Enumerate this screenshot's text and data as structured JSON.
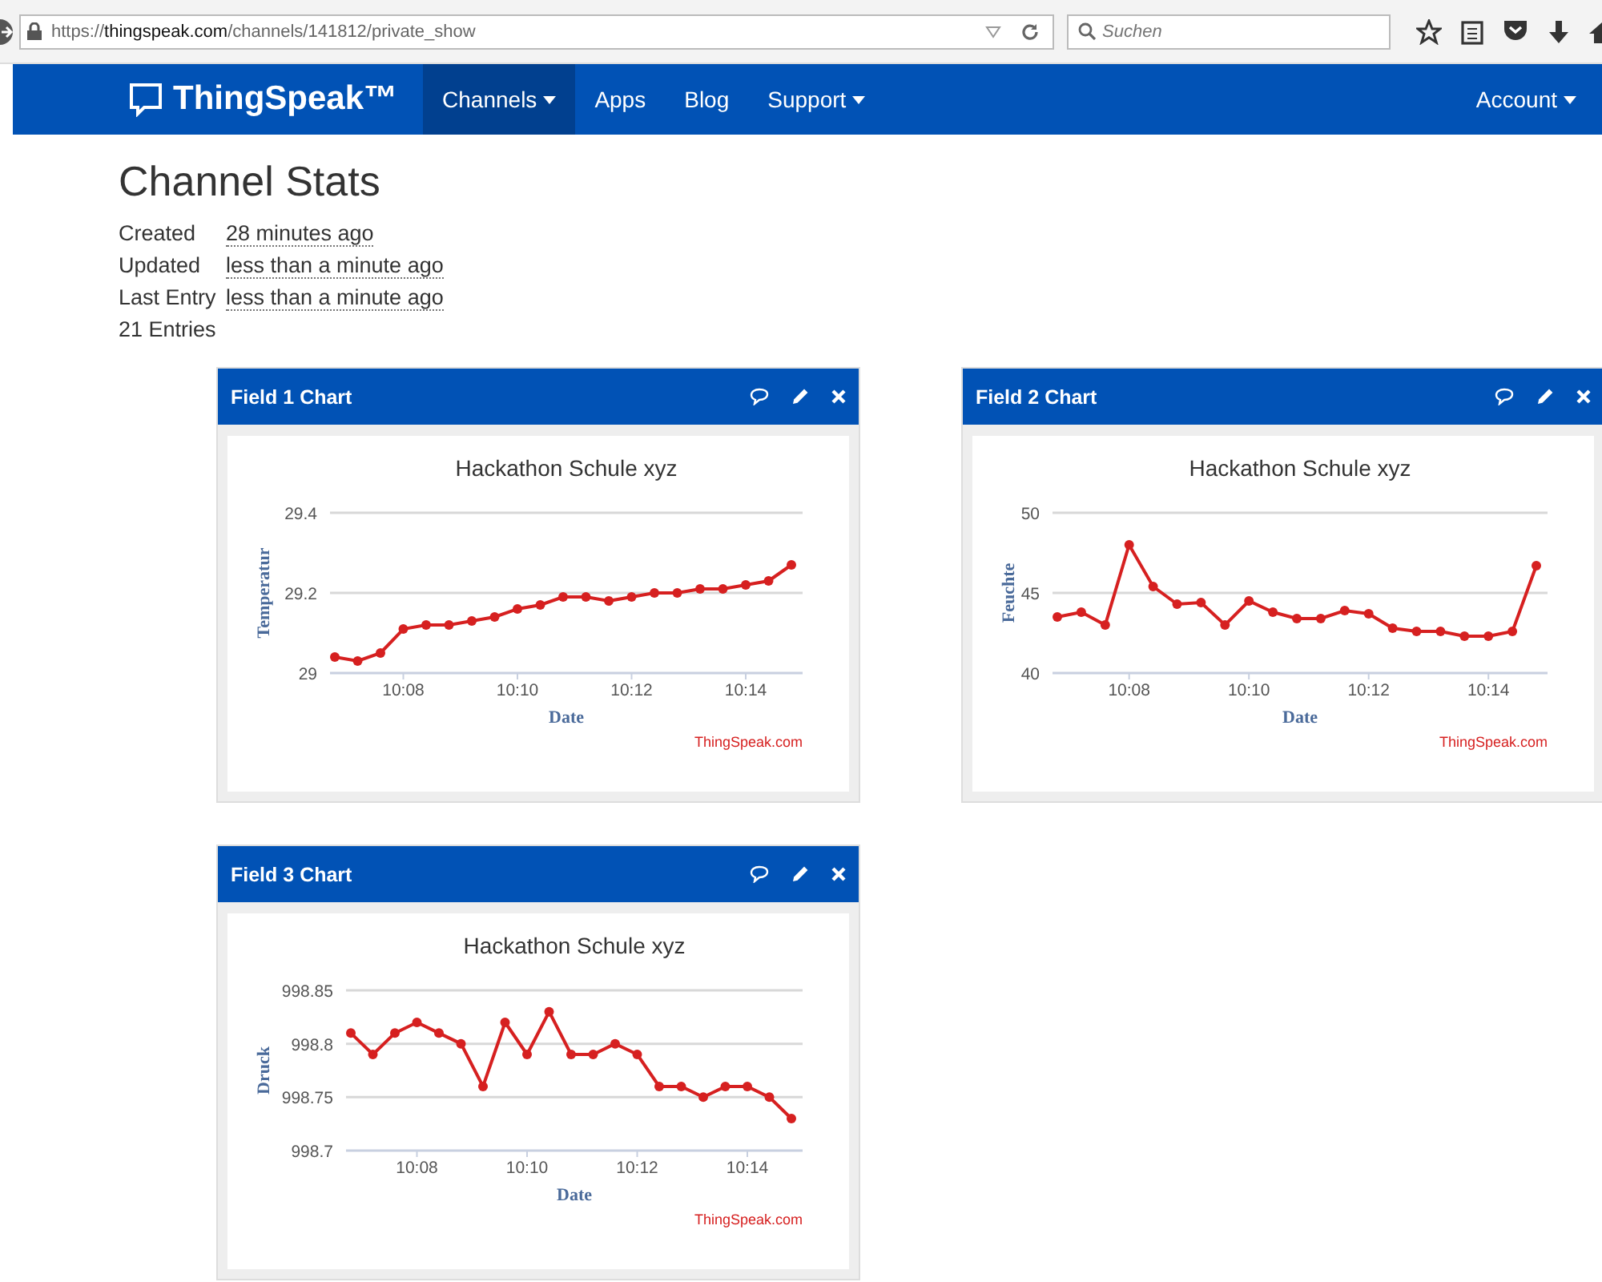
{
  "browser": {
    "url": "https://thingspeak.com/channels/141812/private_show",
    "search": {
      "placeholder": "Suchen"
    }
  },
  "nav": {
    "logo": "ThingSpeak™",
    "items": [
      {
        "label": "Channels",
        "dropdown": true,
        "selected": true
      },
      {
        "label": "Apps",
        "dropdown": false,
        "selected": false
      },
      {
        "label": "Blog",
        "dropdown": false,
        "selected": false
      },
      {
        "label": "Support",
        "dropdown": true,
        "selected": false
      }
    ],
    "account": {
      "label": "Account",
      "dropdown": true
    }
  },
  "page": {
    "title": "Channel Stats",
    "stats": [
      {
        "label": "Created",
        "value": "28 minutes ago"
      },
      {
        "label": "Updated",
        "value": "less than a minute ago"
      },
      {
        "label": "Last Entry",
        "value": "less than a minute ago"
      }
    ],
    "entries": "21 Entries"
  },
  "charts": [
    {
      "title": "Field 1 Chart",
      "chart_data": {
        "type": "line",
        "title": "Hackathon Schule xyz",
        "xlabel": "Date",
        "ylabel": "Temperatur",
        "categories": [
          null,
          null,
          null,
          "10:08",
          null,
          null,
          null,
          null,
          "10:10",
          null,
          null,
          null,
          null,
          "10:12",
          null,
          null,
          null,
          null,
          "10:14",
          null,
          null
        ],
        "series": [
          {
            "color": "#d62020",
            "marker": true,
            "values": [
              29.04,
              29.03,
              29.05,
              29.11,
              29.12,
              29.12,
              29.13,
              29.14,
              29.16,
              29.17,
              29.19,
              29.19,
              29.18,
              29.19,
              29.2,
              29.2,
              29.21,
              29.21,
              29.22,
              29.23,
              29.27
            ]
          }
        ],
        "ylim": [
          29,
          29.4
        ],
        "yticks": [
          {
            "value": 29,
            "label": "29"
          },
          {
            "value": 29.2,
            "label": "29.2"
          },
          {
            "value": 29.4,
            "label": "29.4"
          }
        ]
      },
      "credit": "ThingSpeak.com"
    },
    {
      "title": "Field 2 Chart",
      "chart_data": {
        "type": "line",
        "title": "Hackathon Schule xyz",
        "xlabel": "Date",
        "ylabel": "Feuchte",
        "categories": [
          null,
          null,
          null,
          "10:08",
          null,
          null,
          null,
          null,
          "10:10",
          null,
          null,
          null,
          null,
          "10:12",
          null,
          null,
          null,
          null,
          "10:14",
          null,
          null
        ],
        "series": [
          {
            "color": "#d62020",
            "marker": true,
            "values": [
              43.5,
              43.8,
              43.0,
              48.0,
              45.4,
              44.3,
              44.4,
              43.0,
              44.5,
              43.8,
              43.4,
              43.4,
              43.9,
              43.7,
              42.8,
              42.6,
              42.6,
              42.3,
              42.3,
              42.6,
              46.7
            ]
          }
        ],
        "ylim": [
          40,
          50
        ],
        "yticks": [
          40,
          45,
          50
        ]
      },
      "credit": "ThingSpeak.com"
    },
    {
      "title": "Field 3 Chart",
      "chart_data": {
        "type": "line",
        "title": "Hackathon Schule xyz",
        "xlabel": "Date",
        "ylabel": "Druck",
        "categories": [
          null,
          null,
          null,
          "10:08",
          null,
          null,
          null,
          null,
          "10:10",
          null,
          null,
          null,
          null,
          "10:12",
          null,
          null,
          null,
          null,
          "10:14",
          null,
          null
        ],
        "series": [
          {
            "color": "#d62020",
            "marker": true,
            "values": [
              998.81,
              998.79,
              998.81,
              998.82,
              998.81,
              998.8,
              998.76,
              998.82,
              998.79,
              998.83,
              998.79,
              998.79,
              998.8,
              998.79,
              998.76,
              998.76,
              998.75,
              998.76,
              998.76,
              998.75,
              998.73
            ]
          }
        ],
        "ylim": [
          998.7,
          998.85
        ],
        "yticks": [
          {
            "value": 998.7,
            "label": "998.7"
          },
          {
            "value": 998.75,
            "label": "998.75"
          },
          {
            "value": 998.8,
            "label": "998.8"
          },
          {
            "value": 998.85,
            "label": "998.85"
          }
        ]
      },
      "credit": "ThingSpeak.com"
    }
  ]
}
